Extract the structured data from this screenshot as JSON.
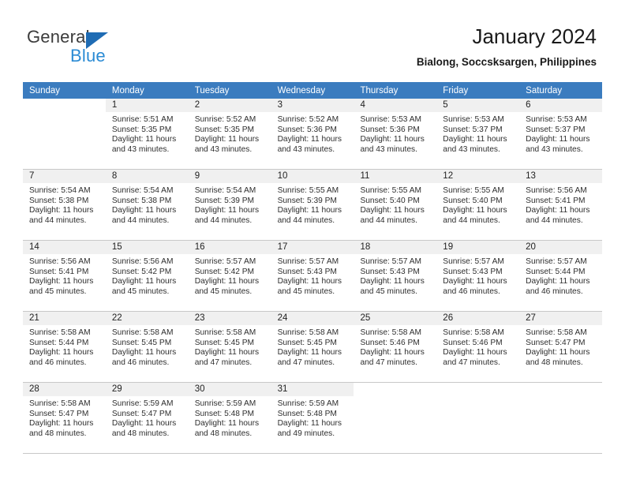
{
  "brand": {
    "name_part1": "General",
    "name_part2": "Blue",
    "triangle_color": "#1f6cb4",
    "blue_color": "#2b8bd4"
  },
  "header": {
    "title": "January 2024",
    "subtitle": "Bialong, Soccsksargen, Philippines"
  },
  "theme": {
    "header_bg": "#3b7cbf",
    "header_text": "#ffffff",
    "datebar_bg": "#f0f0f0",
    "grid_line": "#c8c8c8"
  },
  "weekdays": [
    "Sunday",
    "Monday",
    "Tuesday",
    "Wednesday",
    "Thursday",
    "Friday",
    "Saturday"
  ],
  "weeks": [
    [
      {
        "day": "",
        "sunrise": "",
        "sunset": "",
        "daylight_line1": "",
        "daylight_line2": ""
      },
      {
        "day": "1",
        "sunrise": "Sunrise: 5:51 AM",
        "sunset": "Sunset: 5:35 PM",
        "daylight_line1": "Daylight: 11 hours",
        "daylight_line2": "and 43 minutes."
      },
      {
        "day": "2",
        "sunrise": "Sunrise: 5:52 AM",
        "sunset": "Sunset: 5:35 PM",
        "daylight_line1": "Daylight: 11 hours",
        "daylight_line2": "and 43 minutes."
      },
      {
        "day": "3",
        "sunrise": "Sunrise: 5:52 AM",
        "sunset": "Sunset: 5:36 PM",
        "daylight_line1": "Daylight: 11 hours",
        "daylight_line2": "and 43 minutes."
      },
      {
        "day": "4",
        "sunrise": "Sunrise: 5:53 AM",
        "sunset": "Sunset: 5:36 PM",
        "daylight_line1": "Daylight: 11 hours",
        "daylight_line2": "and 43 minutes."
      },
      {
        "day": "5",
        "sunrise": "Sunrise: 5:53 AM",
        "sunset": "Sunset: 5:37 PM",
        "daylight_line1": "Daylight: 11 hours",
        "daylight_line2": "and 43 minutes."
      },
      {
        "day": "6",
        "sunrise": "Sunrise: 5:53 AM",
        "sunset": "Sunset: 5:37 PM",
        "daylight_line1": "Daylight: 11 hours",
        "daylight_line2": "and 43 minutes."
      }
    ],
    [
      {
        "day": "7",
        "sunrise": "Sunrise: 5:54 AM",
        "sunset": "Sunset: 5:38 PM",
        "daylight_line1": "Daylight: 11 hours",
        "daylight_line2": "and 44 minutes."
      },
      {
        "day": "8",
        "sunrise": "Sunrise: 5:54 AM",
        "sunset": "Sunset: 5:38 PM",
        "daylight_line1": "Daylight: 11 hours",
        "daylight_line2": "and 44 minutes."
      },
      {
        "day": "9",
        "sunrise": "Sunrise: 5:54 AM",
        "sunset": "Sunset: 5:39 PM",
        "daylight_line1": "Daylight: 11 hours",
        "daylight_line2": "and 44 minutes."
      },
      {
        "day": "10",
        "sunrise": "Sunrise: 5:55 AM",
        "sunset": "Sunset: 5:39 PM",
        "daylight_line1": "Daylight: 11 hours",
        "daylight_line2": "and 44 minutes."
      },
      {
        "day": "11",
        "sunrise": "Sunrise: 5:55 AM",
        "sunset": "Sunset: 5:40 PM",
        "daylight_line1": "Daylight: 11 hours",
        "daylight_line2": "and 44 minutes."
      },
      {
        "day": "12",
        "sunrise": "Sunrise: 5:55 AM",
        "sunset": "Sunset: 5:40 PM",
        "daylight_line1": "Daylight: 11 hours",
        "daylight_line2": "and 44 minutes."
      },
      {
        "day": "13",
        "sunrise": "Sunrise: 5:56 AM",
        "sunset": "Sunset: 5:41 PM",
        "daylight_line1": "Daylight: 11 hours",
        "daylight_line2": "and 44 minutes."
      }
    ],
    [
      {
        "day": "14",
        "sunrise": "Sunrise: 5:56 AM",
        "sunset": "Sunset: 5:41 PM",
        "daylight_line1": "Daylight: 11 hours",
        "daylight_line2": "and 45 minutes."
      },
      {
        "day": "15",
        "sunrise": "Sunrise: 5:56 AM",
        "sunset": "Sunset: 5:42 PM",
        "daylight_line1": "Daylight: 11 hours",
        "daylight_line2": "and 45 minutes."
      },
      {
        "day": "16",
        "sunrise": "Sunrise: 5:57 AM",
        "sunset": "Sunset: 5:42 PM",
        "daylight_line1": "Daylight: 11 hours",
        "daylight_line2": "and 45 minutes."
      },
      {
        "day": "17",
        "sunrise": "Sunrise: 5:57 AM",
        "sunset": "Sunset: 5:43 PM",
        "daylight_line1": "Daylight: 11 hours",
        "daylight_line2": "and 45 minutes."
      },
      {
        "day": "18",
        "sunrise": "Sunrise: 5:57 AM",
        "sunset": "Sunset: 5:43 PM",
        "daylight_line1": "Daylight: 11 hours",
        "daylight_line2": "and 45 minutes."
      },
      {
        "day": "19",
        "sunrise": "Sunrise: 5:57 AM",
        "sunset": "Sunset: 5:43 PM",
        "daylight_line1": "Daylight: 11 hours",
        "daylight_line2": "and 46 minutes."
      },
      {
        "day": "20",
        "sunrise": "Sunrise: 5:57 AM",
        "sunset": "Sunset: 5:44 PM",
        "daylight_line1": "Daylight: 11 hours",
        "daylight_line2": "and 46 minutes."
      }
    ],
    [
      {
        "day": "21",
        "sunrise": "Sunrise: 5:58 AM",
        "sunset": "Sunset: 5:44 PM",
        "daylight_line1": "Daylight: 11 hours",
        "daylight_line2": "and 46 minutes."
      },
      {
        "day": "22",
        "sunrise": "Sunrise: 5:58 AM",
        "sunset": "Sunset: 5:45 PM",
        "daylight_line1": "Daylight: 11 hours",
        "daylight_line2": "and 46 minutes."
      },
      {
        "day": "23",
        "sunrise": "Sunrise: 5:58 AM",
        "sunset": "Sunset: 5:45 PM",
        "daylight_line1": "Daylight: 11 hours",
        "daylight_line2": "and 47 minutes."
      },
      {
        "day": "24",
        "sunrise": "Sunrise: 5:58 AM",
        "sunset": "Sunset: 5:45 PM",
        "daylight_line1": "Daylight: 11 hours",
        "daylight_line2": "and 47 minutes."
      },
      {
        "day": "25",
        "sunrise": "Sunrise: 5:58 AM",
        "sunset": "Sunset: 5:46 PM",
        "daylight_line1": "Daylight: 11 hours",
        "daylight_line2": "and 47 minutes."
      },
      {
        "day": "26",
        "sunrise": "Sunrise: 5:58 AM",
        "sunset": "Sunset: 5:46 PM",
        "daylight_line1": "Daylight: 11 hours",
        "daylight_line2": "and 47 minutes."
      },
      {
        "day": "27",
        "sunrise": "Sunrise: 5:58 AM",
        "sunset": "Sunset: 5:47 PM",
        "daylight_line1": "Daylight: 11 hours",
        "daylight_line2": "and 48 minutes."
      }
    ],
    [
      {
        "day": "28",
        "sunrise": "Sunrise: 5:58 AM",
        "sunset": "Sunset: 5:47 PM",
        "daylight_line1": "Daylight: 11 hours",
        "daylight_line2": "and 48 minutes."
      },
      {
        "day": "29",
        "sunrise": "Sunrise: 5:59 AM",
        "sunset": "Sunset: 5:47 PM",
        "daylight_line1": "Daylight: 11 hours",
        "daylight_line2": "and 48 minutes."
      },
      {
        "day": "30",
        "sunrise": "Sunrise: 5:59 AM",
        "sunset": "Sunset: 5:48 PM",
        "daylight_line1": "Daylight: 11 hours",
        "daylight_line2": "and 48 minutes."
      },
      {
        "day": "31",
        "sunrise": "Sunrise: 5:59 AM",
        "sunset": "Sunset: 5:48 PM",
        "daylight_line1": "Daylight: 11 hours",
        "daylight_line2": "and 49 minutes."
      },
      {
        "day": "",
        "sunrise": "",
        "sunset": "",
        "daylight_line1": "",
        "daylight_line2": ""
      },
      {
        "day": "",
        "sunrise": "",
        "sunset": "",
        "daylight_line1": "",
        "daylight_line2": ""
      },
      {
        "day": "",
        "sunrise": "",
        "sunset": "",
        "daylight_line1": "",
        "daylight_line2": ""
      }
    ]
  ]
}
